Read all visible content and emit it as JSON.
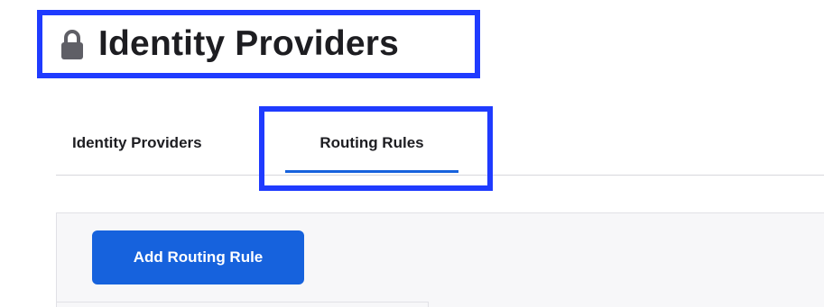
{
  "header": {
    "title": "Identity Providers",
    "title_icon": "lock-icon"
  },
  "tabs": [
    {
      "label": "Identity Providers",
      "active": false
    },
    {
      "label": "Routing Rules",
      "active": true
    }
  ],
  "toolbar": {
    "add_button_label": "Add Routing Rule"
  },
  "colors": {
    "accent": "#1662dd",
    "highlight_box": "#1f3bff",
    "text": "#1d1d21",
    "panel_bg": "#f7f7f9"
  }
}
